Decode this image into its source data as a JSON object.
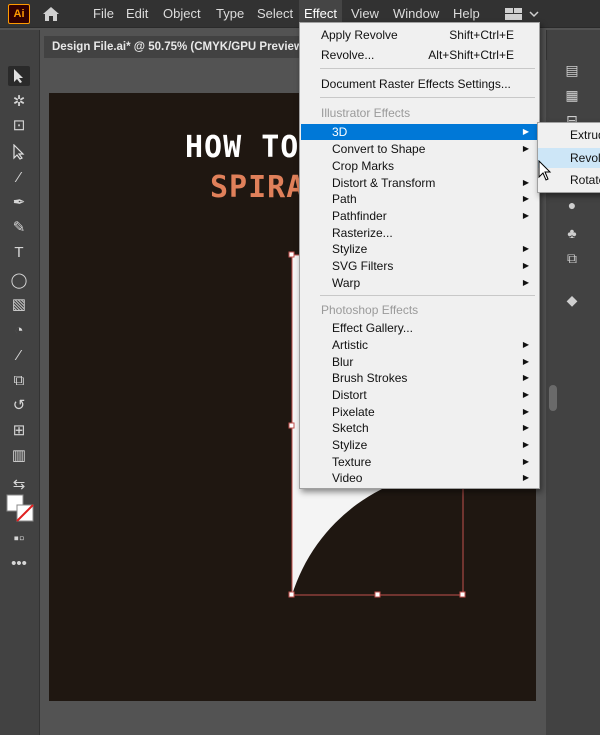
{
  "app": {
    "logo_text": "Ai"
  },
  "menubar": {
    "items": [
      "File",
      "Edit",
      "Object",
      "Type",
      "Select",
      "Effect",
      "View",
      "Window",
      "Help"
    ],
    "active": "Effect"
  },
  "document": {
    "tab_title": "Design File.ai* @ 50.75% (CMYK/GPU Preview"
  },
  "artboard": {
    "heading_line1": "HOW TO",
    "heading_line2": "SPIRAL"
  },
  "effect_menu": {
    "apply_revolve": {
      "label": "Apply Revolve",
      "shortcut": "Shift+Ctrl+E"
    },
    "revolve": {
      "label": "Revolve...",
      "shortcut": "Alt+Shift+Ctrl+E"
    },
    "raster_settings": "Document Raster Effects Settings...",
    "illustrator_header": "Illustrator Effects",
    "illustrator_items": [
      "3D",
      "Convert to Shape",
      "Crop Marks",
      "Distort & Transform",
      "Path",
      "Pathfinder",
      "Rasterize...",
      "Stylize",
      "SVG Filters",
      "Warp"
    ],
    "photoshop_header": "Photoshop Effects",
    "photoshop_items": [
      "Effect Gallery...",
      "Artistic",
      "Blur",
      "Brush Strokes",
      "Distort",
      "Pixelate",
      "Sketch",
      "Stylize",
      "Texture",
      "Video"
    ]
  },
  "submenu_3d": {
    "items": [
      "Extrude & Bevel...",
      "Revolve...",
      "Rotate..."
    ]
  },
  "colors": {
    "highlight": "#0078d7",
    "artboard": "#1f1711",
    "accent_text": "#e0805a"
  }
}
